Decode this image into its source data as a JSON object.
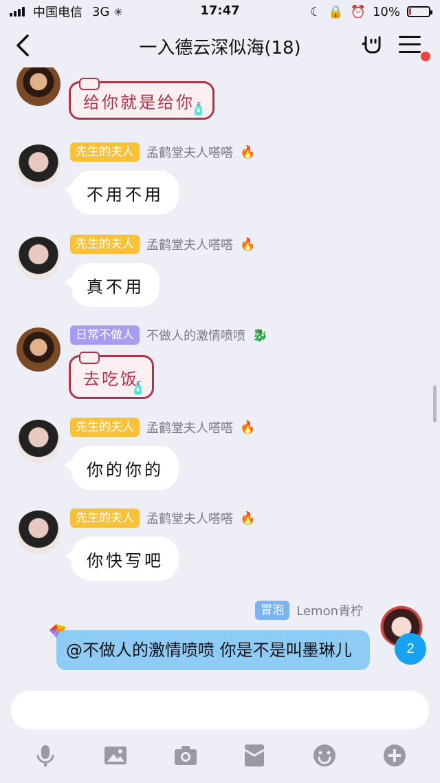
{
  "status_bar": {
    "carrier": "中国电信",
    "network": "3G",
    "time": "17:47",
    "battery_percent": "10%",
    "battery_level": 0.1
  },
  "header": {
    "title": "一入德云深似海(18)"
  },
  "messages": [
    {
      "sticker_text": "给你就是给你"
    },
    {
      "rank": "先生的夫人",
      "nick": "孟鹤堂夫人嗒嗒",
      "badge": "🔥",
      "text": "不用不用"
    },
    {
      "rank": "先生的夫人",
      "nick": "孟鹤堂夫人嗒嗒",
      "badge": "🔥",
      "text": "真不用"
    },
    {
      "rank": "日常不做人",
      "nick": "不做人的激情喷喷",
      "badge": "🐉",
      "sticker_text": "去吃饭"
    },
    {
      "rank": "先生的夫人",
      "nick": "孟鹤堂夫人嗒嗒",
      "badge": "🔥",
      "text": "你的你的"
    },
    {
      "rank": "先生的夫人",
      "nick": "孟鹤堂夫人嗒嗒",
      "badge": "🔥",
      "text": "你快写吧"
    },
    {
      "rank": "冒泡",
      "nick": "Lemon青柠",
      "text": "@不做人的激情喷喷 你是不是叫墨琳儿"
    }
  ],
  "unread_count": "2",
  "colors": {
    "rank_gold": "#f7c23a",
    "rank_purple": "#a79df0",
    "rank_blue": "#7bb3f3",
    "self_bubble": "#8ecbf5",
    "unread_badge": "#17a3f0"
  },
  "toolbar": {
    "icons": [
      "microphone-icon",
      "image-icon",
      "camera-icon",
      "red-packet-icon",
      "emoji-icon",
      "plus-icon"
    ]
  }
}
